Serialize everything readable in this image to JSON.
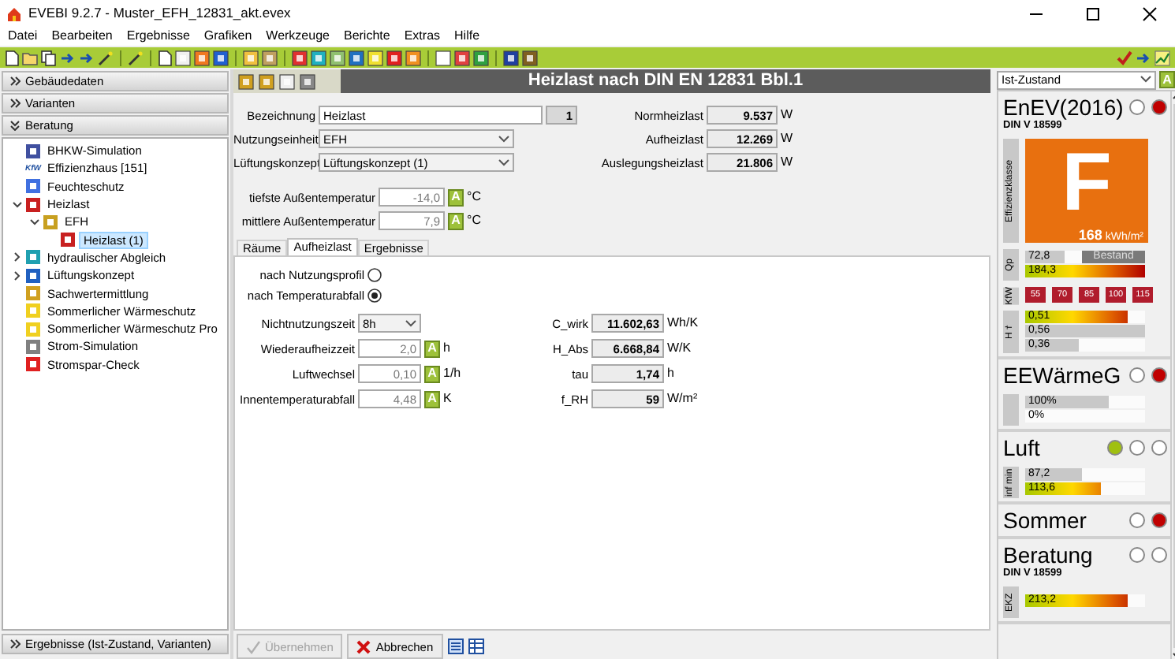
{
  "window": {
    "title": "EVEBI 9.2.7 - Muster_EFH_12831_akt.evex"
  },
  "menu": [
    "Datei",
    "Bearbeiten",
    "Ergebnisse",
    "Grafiken",
    "Werkzeuge",
    "Berichte",
    "Extras",
    "Hilfe"
  ],
  "sidebar": {
    "sections": [
      {
        "label": "Gebäudedaten",
        "expanded": false
      },
      {
        "label": "Varianten",
        "expanded": false
      },
      {
        "label": "Beratung",
        "expanded": true
      }
    ],
    "tree": [
      {
        "label": "BHKW-Simulation",
        "color": "#4050a0",
        "selected": false
      },
      {
        "label": "Effizienzhaus [151]",
        "icon_text": "KfW",
        "color": "#2050a0",
        "selected": false
      },
      {
        "label": "Feuchteschutz",
        "color": "#4070e0",
        "selected": false
      },
      {
        "label": "Heizlast",
        "color": "#c82020",
        "selected": false,
        "expanded": true,
        "children": [
          {
            "label": "EFH",
            "color": "#c8a020",
            "selected": false,
            "expanded": true,
            "children": [
              {
                "label": "Heizlast (1)",
                "color": "#c82020",
                "selected": true
              }
            ]
          }
        ]
      },
      {
        "label": "hydraulischer Abgleich",
        "color": "#20a0b0",
        "selected": false,
        "expanded": false
      },
      {
        "label": "Lüftungskonzept",
        "color": "#2060c0",
        "selected": false,
        "expanded": false
      },
      {
        "label": "Sachwertermittlung",
        "color": "#d0a020",
        "selected": false
      },
      {
        "label": "Sommerlicher Wärmeschutz",
        "color": "#f0d020",
        "selected": false
      },
      {
        "label": "Sommerlicher Wärmeschutz Pro",
        "color": "#f0d020",
        "selected": false
      },
      {
        "label": "Strom-Simulation",
        "color": "#808080",
        "selected": false
      },
      {
        "label": "Stromspar-Check",
        "color": "#e02020",
        "selected": false
      }
    ],
    "bottom_section": {
      "label": "Ergebnisse (Ist-Zustand, Varianten)",
      "expanded": false
    }
  },
  "panel": {
    "title": "Heizlast nach DIN EN 12831 Bbl.1",
    "bezeichnung": {
      "label": "Bezeichnung",
      "value": "Heizlast",
      "count": "1"
    },
    "selects": [
      {
        "label": "Nutzungseinheit",
        "value": "EFH"
      },
      {
        "label": "Lüftungskonzept",
        "value": "Lüftungskonzept (1)"
      }
    ],
    "results": [
      {
        "label": "Normheizlast",
        "value": "9.537",
        "unit": "W"
      },
      {
        "label": "Aufheizlast",
        "value": "12.269",
        "unit": "W"
      },
      {
        "label": "Auslegungsheizlast",
        "value": "21.806",
        "unit": "W"
      }
    ],
    "temperatures": [
      {
        "label": "tiefste Außentemperatur",
        "value": "-14,0",
        "badge": "A",
        "unit": "°C"
      },
      {
        "label": "mittlere Außentemperatur",
        "value": "7,9",
        "badge": "A",
        "unit": "°C"
      }
    ],
    "tabs": [
      {
        "label": "Räume",
        "selected": false
      },
      {
        "label": "Aufheizlast",
        "selected": true
      },
      {
        "label": "Ergebnisse",
        "selected": false
      }
    ],
    "radios": [
      {
        "label": "nach Nutzungsprofil",
        "selected": false
      },
      {
        "label": "nach Temperaturabfall",
        "selected": true
      }
    ],
    "inputs": [
      {
        "kind": "select",
        "label": "Nichtnutzungszeit",
        "value": "8h"
      },
      {
        "kind": "field",
        "label": "Wiederaufheizzeit",
        "value": "2,0",
        "badge": "A",
        "unit": "h"
      },
      {
        "kind": "field",
        "label": "Luftwechsel",
        "value": "0,10",
        "badge": "A",
        "unit": "1/h"
      },
      {
        "kind": "field",
        "label": "Innentemperaturabfall",
        "value": "4,48",
        "badge": "A",
        "unit": "K"
      }
    ],
    "outputs": [
      {
        "label": "C_wirk",
        "value": "11.602,63",
        "unit": "Wh/K"
      },
      {
        "label": "H_Abs",
        "value": "6.668,84",
        "unit": "W/K"
      },
      {
        "label": "tau",
        "value": "1,74",
        "unit": "h"
      },
      {
        "label": "f_RH",
        "value": "59",
        "unit": "W/m²"
      }
    ],
    "buttons": [
      {
        "label": "Übernehmen",
        "kind": "apply",
        "disabled": true
      },
      {
        "label": "Abbrechen",
        "kind": "cancel",
        "disabled": false
      }
    ]
  },
  "status_panel": {
    "variant": "Ist-Zustand",
    "badge": "A",
    "sections": [
      {
        "title": "EnEV(2016)",
        "subtitle": "DIN V 18599",
        "lights": [
          {
            "color": "#ffffff"
          },
          {
            "color": "#c00000"
          }
        ],
        "rows": [
          {
            "kind": "class",
            "label": "Effizienzklasse",
            "class": "F",
            "value": "168",
            "unit": "kWh/m²",
            "color": "#e8700f"
          },
          {
            "kind": "bars",
            "label": "Qp",
            "bars": [
              {
                "text": "72,8",
                "kind": "plain",
                "level": 0.33,
                "tag": "Bestand"
              },
              {
                "text": "184,3",
                "kind": "scale",
                "level": 1.0
              }
            ]
          },
          {
            "kind": "steps",
            "label": "KfW",
            "steps": [
              "55",
              "70",
              "85",
              "100",
              "115"
            ]
          },
          {
            "kind": "bars",
            "label": "H$_{T}$'",
            "bars": [
              {
                "text": "0,51",
                "kind": "scale",
                "level": 0.86
              },
              {
                "text": "0,56",
                "kind": "plain",
                "level": 1.0
              },
              {
                "text": "0,36",
                "kind": "plain",
                "level": 0.45
              }
            ]
          }
        ]
      },
      {
        "title": "EEWärmeG",
        "lights": [
          {
            "color": "#ffffff"
          },
          {
            "color": "#c00000"
          }
        ],
        "rows": [
          {
            "kind": "bars",
            "bars": [
              {
                "text": "100%",
                "kind": "plain",
                "level": 0.7
              },
              {
                "text": "0%",
                "kind": "plain",
                "level": 0
              }
            ]
          }
        ]
      },
      {
        "title": "Luft",
        "lights": [
          {
            "color": "#a0c010"
          },
          {
            "color": "#ffffff"
          },
          {
            "color": "#ffffff"
          }
        ],
        "rows": [
          {
            "kind": "bars",
            "label": "inf min",
            "bars": [
              {
                "text": "87,2",
                "kind": "plain",
                "level": 0.48
              },
              {
                "text": "113,6",
                "kind": "scale",
                "level": 0.63
              }
            ]
          }
        ]
      },
      {
        "title": "Sommer",
        "lights": [
          {
            "color": "#ffffff"
          },
          {
            "color": "#c00000"
          }
        ]
      },
      {
        "title": "Beratung",
        "subtitle": "DIN V 18599",
        "lights": [
          {
            "color": "#ffffff"
          },
          {
            "color": "#ffffff"
          }
        ],
        "rows": [
          {
            "kind": "bars",
            "label": "EKZ",
            "bars": [
              {
                "text": "213,2",
                "kind": "scale",
                "level": 0.86
              }
            ]
          }
        ]
      }
    ]
  }
}
